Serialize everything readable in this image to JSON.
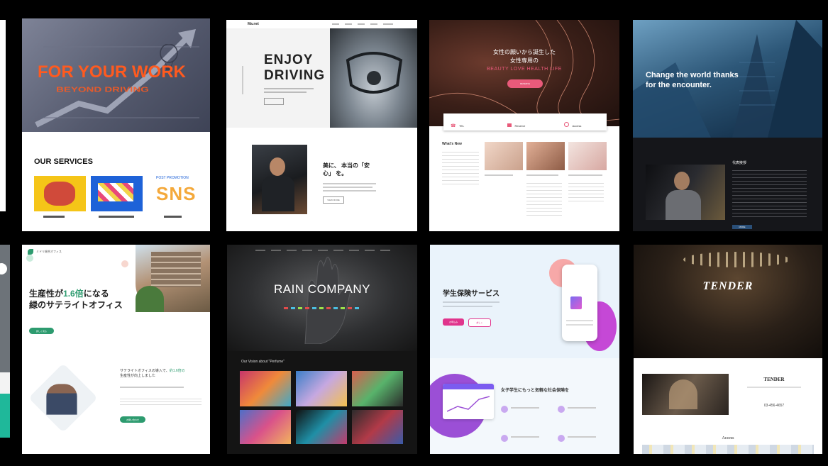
{
  "cards": {
    "work": {
      "headline": "FOR YOUR WORK",
      "subline": "BEYOND DRIVING",
      "services_title": "OUR SERVICES",
      "svc_label_3": "SNS",
      "svc_tag_3": "POST  PROMOTION",
      "colors": {
        "accent": "#ff5a1f",
        "hero_bg": "#5a6075"
      }
    },
    "driving": {
      "logo": "Ma.net",
      "headline_1": "ENJOY",
      "headline_2": "DRIVING",
      "section_text": "美に、 本当の「安心」 を。",
      "button": "VIEW MORE"
    },
    "beauty": {
      "headline_1": "女性の願いから誕生した",
      "headline_2": "女性専用の",
      "subline": "BEAUTY LOVE HEALTH LIFE",
      "cta": "RESERVE",
      "info_1": "TEL",
      "info_2": "Reserve",
      "info_3": "Access",
      "section_title": "What's New",
      "colors": {
        "accent": "#e85a7a"
      }
    },
    "business": {
      "headline_1": "Change the world thanks",
      "headline_2": "for the encounter.",
      "section_title": "代表挨拶",
      "button": "MORE"
    },
    "office": {
      "logo": "ミドリ総合オフィス",
      "headline_1a": "生産性が",
      "headline_1b": "1.6倍",
      "headline_1c": "になる",
      "headline_2": "緑のサテライトオフィス",
      "cta": "詳しく見る",
      "sub_1": "サテライトオフィスの導入で、",
      "sub_1b": "約1.6倍の",
      "sub_2": "生産性が向上しました",
      "cta_2": "お問い合わせ",
      "colors": {
        "accent": "#2d9b6f"
      }
    },
    "rain": {
      "headline": "RAIN COMPANY",
      "section_title": "Our Vision about \"Perfume\""
    },
    "student": {
      "headline": "学生保険サービス",
      "sub": "女子学生にもっと気軽な社会保険を",
      "btn_1": "お申込み",
      "btn_2": "詳しく",
      "colors": {
        "accent": "#e0348c",
        "purple": "#9b4fd6"
      }
    },
    "tender": {
      "headline": "TENDER",
      "name": "TENDER",
      "phone": "03-456-4657",
      "section_title": "Access"
    }
  },
  "icons": {
    "balloon": "balloon-icon",
    "arrow": "arrow-up-icon",
    "phone": "phone-icon"
  }
}
